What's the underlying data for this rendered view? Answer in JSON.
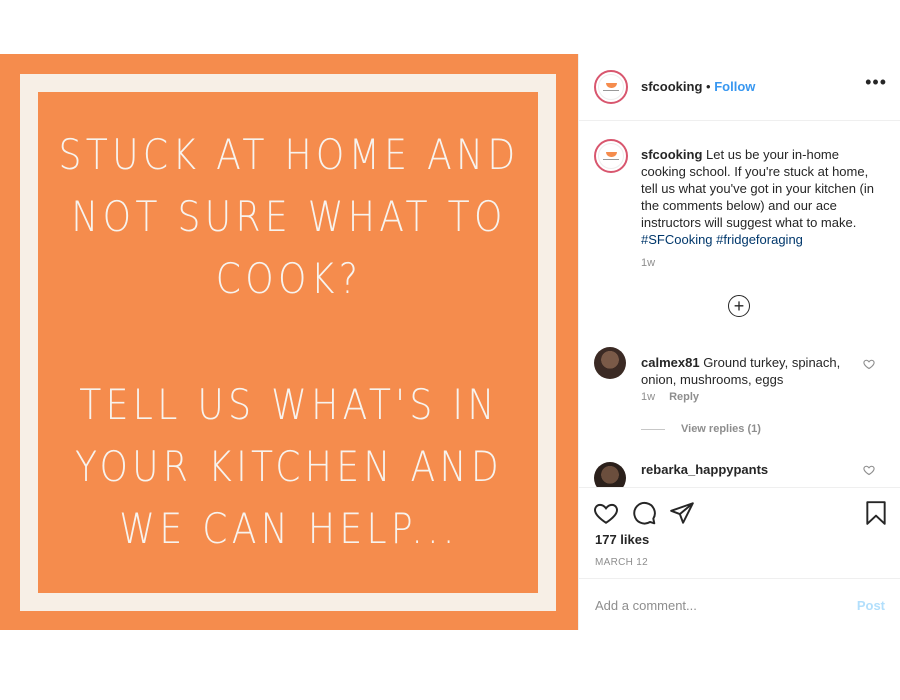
{
  "post": {
    "image_text": {
      "line_group_1": "STUCK AT HOME AND\nNOT SURE WHAT TO\nCOOK?",
      "line_group_2": "TELL US WHAT'S IN\nYOUR KITCHEN AND\nWE CAN HELP..."
    },
    "colors": {
      "poster_bg": "#f58c4d",
      "poster_frame": "#f7efe6",
      "link": "#3897f0",
      "hashtag": "#00376b"
    }
  },
  "header": {
    "username": "sfcooking",
    "separator": "•",
    "follow_label": "Follow",
    "more_icon": "more-horizontal-icon"
  },
  "caption": {
    "username": "sfcooking",
    "text": "Let us be your in-home cooking school. If you're stuck at home, tell us what you've got in your kitchen (in the comments below) and our ace instructors will suggest what to make.",
    "hashtag_1": "#SFCooking",
    "hashtag_2": "#fridgeforaging",
    "time": "1w"
  },
  "comments": [
    {
      "username": "calmex81",
      "text": "Ground turkey, spinach, onion, mushrooms, eggs",
      "time": "1w",
      "reply_label": "Reply",
      "view_replies": "View replies (1)"
    },
    {
      "username": "rebarka_happypants",
      "text": ""
    }
  ],
  "actions": {
    "icons": [
      "heart-icon",
      "comment-icon",
      "share-icon",
      "bookmark-icon"
    ]
  },
  "likes": "177 likes",
  "date": "MARCH 12",
  "add_comment": {
    "placeholder": "Add a comment...",
    "post_label": "Post"
  }
}
